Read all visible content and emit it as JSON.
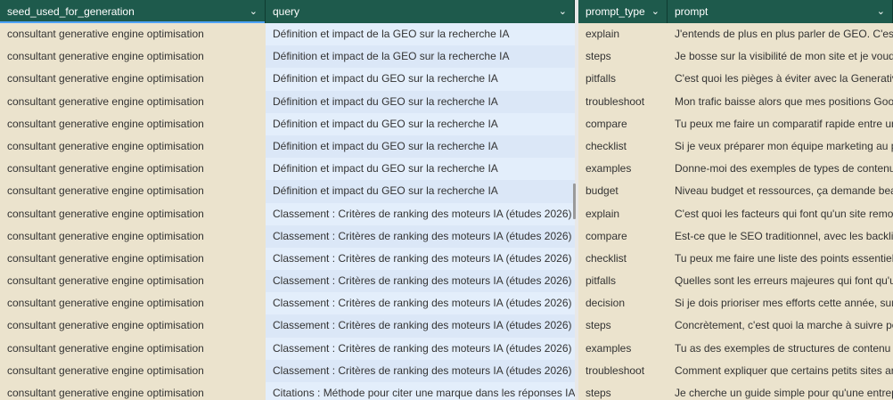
{
  "columns": [
    {
      "label": "seed_used_for_generation"
    },
    {
      "label": "query"
    },
    {
      "label": "prompt_type"
    },
    {
      "label": "prompt"
    }
  ],
  "rows": [
    {
      "seed": "consultant generative engine optimisation",
      "query": "Définition et impact de la GEO sur la recherche IA",
      "type": "explain",
      "prompt": "J'entends de plus en plus parler de GEO. C'est quoi"
    },
    {
      "seed": "consultant generative engine optimisation",
      "query": "Définition et impact de la GEO sur la recherche IA",
      "type": "steps",
      "prompt": "Je bosse sur la visibilité de mon site et je voudrais"
    },
    {
      "seed": "consultant generative engine optimisation",
      "query": "Définition et impact du GEO sur la recherche IA",
      "type": "pitfalls",
      "prompt": "C'est quoi les pièges à éviter avec la Generative En"
    },
    {
      "seed": "consultant generative engine optimisation",
      "query": "Définition et impact du GEO sur la recherche IA",
      "type": "troubleshoot",
      "prompt": "Mon trafic baisse alors que mes positions Google"
    },
    {
      "seed": "consultant generative engine optimisation",
      "query": "Définition et impact du GEO sur la recherche IA",
      "type": "compare",
      "prompt": "Tu peux me faire un comparatif rapide entre une s"
    },
    {
      "seed": "consultant generative engine optimisation",
      "query": "Définition et impact du GEO sur la recherche IA",
      "type": "checklist",
      "prompt": "Si je veux préparer mon équipe marketing au pass"
    },
    {
      "seed": "consultant generative engine optimisation",
      "query": "Définition et impact du GEO sur la recherche IA",
      "type": "examples",
      "prompt": "Donne-moi des exemples de types de contenus qu"
    },
    {
      "seed": "consultant generative engine optimisation",
      "query": "Définition et impact du GEO sur la recherche IA",
      "type": "budget",
      "prompt": "Niveau budget et ressources, ça demande beaucc"
    },
    {
      "seed": "consultant generative engine optimisation",
      "query": "Classement : Critères de ranking des moteurs IA (études 2026)",
      "type": "explain",
      "prompt": "C'est quoi les facteurs qui font qu'un site remonte"
    },
    {
      "seed": "consultant generative engine optimisation",
      "query": "Classement : Critères de ranking des moteurs IA (études 2026)",
      "type": "compare",
      "prompt": "Est-ce que le SEO traditionnel, avec les backlinks e"
    },
    {
      "seed": "consultant generative engine optimisation",
      "query": "Classement : Critères de ranking des moteurs IA (études 2026)",
      "type": "checklist",
      "prompt": "Tu peux me faire une liste des points essentiels à"
    },
    {
      "seed": "consultant generative engine optimisation",
      "query": "Classement : Critères de ranking des moteurs IA (études 2026)",
      "type": "pitfalls",
      "prompt": "Quelles sont les erreurs majeures qui font qu'un c"
    },
    {
      "seed": "consultant generative engine optimisation",
      "query": "Classement : Critères de ranking des moteurs IA (études 2026)",
      "type": "decision",
      "prompt": "Si je dois prioriser mes efforts cette année, sur qu"
    },
    {
      "seed": "consultant generative engine optimisation",
      "query": "Classement : Critères de ranking des moteurs IA (études 2026)",
      "type": "steps",
      "prompt": "Concrètement, c'est quoi la marche à suivre pour"
    },
    {
      "seed": "consultant generative engine optimisation",
      "query": "Classement : Critères de ranking des moteurs IA (études 2026)",
      "type": "examples",
      "prompt": "Tu as des exemples de structures de contenu qui"
    },
    {
      "seed": "consultant generative engine optimisation",
      "query": "Classement : Critères de ranking des moteurs IA (études 2026)",
      "type": "troubleshoot",
      "prompt": "Comment expliquer que certains petits sites arrive"
    },
    {
      "seed": "consultant generative engine optimisation",
      "query": "Citations : Méthode pour citer une marque dans les réponses IA",
      "type": "steps",
      "prompt": "Je cherche un guide simple pour qu'une entreprise"
    }
  ]
}
